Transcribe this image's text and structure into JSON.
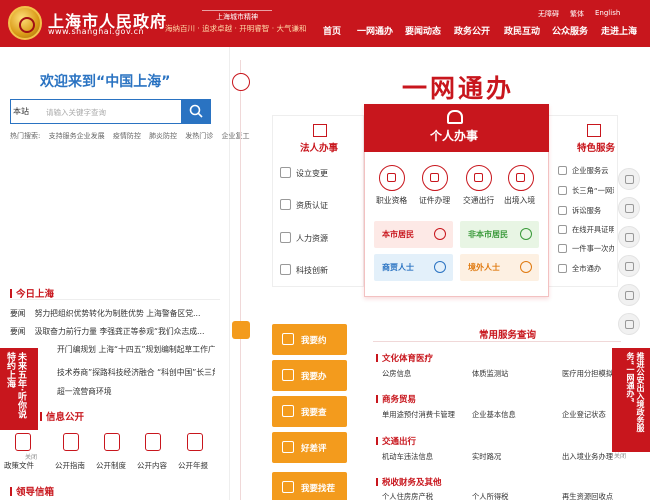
{
  "header": {
    "title": "上海市人民政府",
    "url": "www.shanghai.gov.cn",
    "slogan_title": "上海城市精神",
    "slogan": "海纳百川 · 追求卓越 · 开明睿智 · 大气谦和",
    "util": [
      "无障碍",
      "繁体",
      "English"
    ],
    "nav": [
      "首页",
      "一网通办",
      "要闻动态",
      "政务公开",
      "政民互动",
      "公众服务",
      "走进上海"
    ],
    "colors": {
      "brand": "#c8161d",
      "accent": "#2a73c2",
      "orange": "#f39b1d"
    }
  },
  "left": {
    "welcome": "欢迎来到“中国上海”",
    "search": {
      "scope": "本站",
      "placeholder": "请输入关键字查询"
    },
    "hot_label": "热门搜索:",
    "hot": [
      "支持服务企业发展",
      "疫情防控",
      "肺炎防控",
      "发热门诊",
      "企业复工"
    ],
    "today": {
      "title": "今日上海",
      "items": [
        {
          "tag": "要闻",
          "text": "努力把组织优势转化为制胜优势 上海警备区党..."
        },
        {
          "tag": "要闻",
          "text": "汲取奋力前行力量 李强龚正等参观“我们众志成..."
        },
        {
          "tag": "要闻",
          "text": "上海"
        },
        {
          "tag": "",
          "text": "开门编规划 上海“十四五”规划编制起草工作广..."
        },
        {
          "tag": "",
          "text": "技术券商”探路科技经济融合 “科创中国”长三角..."
        },
        {
          "tag": "",
          "text": "超一流营商环境"
        }
      ]
    },
    "info": {
      "title": "信息公开",
      "items": [
        "政策文件",
        "公开指南",
        "公开制度",
        "公开内容",
        "公开年报"
      ]
    },
    "next_title": "领导信箱",
    "banner": {
      "text": "未来五年·听你说 特约上海",
      "sub": "2021-2025年",
      "close": "关闭"
    }
  },
  "ywb": {
    "title": "一网通办",
    "legal": {
      "title": "法人办事",
      "items": [
        "设立变更",
        "资质认证",
        "人力资源",
        "科技创新"
      ]
    },
    "personal": {
      "title": "个人办事",
      "icons": [
        "职业资格",
        "证件办理",
        "交通出行",
        "出境入境"
      ],
      "cats": [
        "本市居民",
        "非本市居民",
        "商贾人士",
        "境外人士"
      ]
    },
    "special": {
      "title": "特色服务",
      "items": [
        "企业服务云",
        "长三角“一网通办”",
        "诉讼服务",
        "在线开具证明",
        "一件事一次办",
        "全市通办"
      ]
    },
    "buttons": [
      "我要约",
      "我要办",
      "我要查",
      "好差评",
      "我要找茬"
    ],
    "common": {
      "title": "常用服务查询",
      "groups": [
        {
          "title": "文化体育医疗",
          "items": [
            "公房信息",
            "体质监测站",
            "医疗用分担模拟"
          ]
        },
        {
          "title": "商务贸易",
          "items": [
            "单用途预付消费卡管理",
            "企业基本信息",
            "企业登记状态"
          ]
        },
        {
          "title": "交通出行",
          "items": [
            "机动车违法信息",
            "实时路况",
            "出入境业务办理"
          ]
        },
        {
          "title": "税收财务及其他",
          "items": [
            "个人住房房产税",
            "个人所得税",
            "再生资源回收点"
          ]
        }
      ]
    },
    "right_banner": {
      "text": "推进公安出入境政务服务“一网通办”",
      "close": "关闭"
    }
  }
}
